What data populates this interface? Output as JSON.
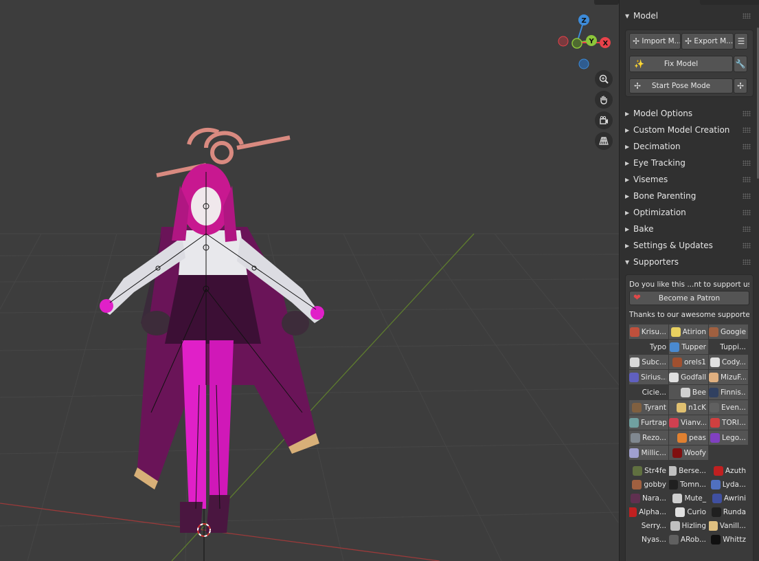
{
  "panel": {
    "model_header": "Model",
    "buttons": {
      "import": "Import M...",
      "export": "Export M...",
      "fix_model": "Fix Model",
      "start_pose_mode": "Start Pose Mode"
    },
    "sections": [
      "Model Options",
      "Custom Model Creation",
      "Decimation",
      "Eye Tracking",
      "Visemes",
      "Bone Parenting",
      "Optimization",
      "Bake",
      "Settings & Updates"
    ],
    "supporters_header": "Supporters",
    "support_question": "Do you like this ...nt to support us?",
    "become_patron": "Become a Patron",
    "thanks_text": "Thanks to our awesome supporte...",
    "supporter_buttons": [
      {
        "name": "Krisu...",
        "color": "#c0503c"
      },
      {
        "name": "Atirion",
        "color": "#e8d060"
      },
      {
        "name": "Googie",
        "color": "#a06040"
      },
      {
        "name": "Typo",
        "color": ""
      },
      {
        "name": "Tupper",
        "color": "#4a8ad0"
      },
      {
        "name": "Tuppi...",
        "color": ""
      },
      {
        "name": "Subc...",
        "color": "#d8d8d8"
      },
      {
        "name": "orels1",
        "color": "#a05030"
      },
      {
        "name": "Cody...",
        "color": "#e0e0e0"
      },
      {
        "name": "Sirius...",
        "color": "#6060c0"
      },
      {
        "name": "Godfall",
        "color": "#e0e0e0"
      },
      {
        "name": "MizuF...",
        "color": "#e0b080"
      },
      {
        "name": "Cicie...",
        "color": ""
      },
      {
        "name": "Bee",
        "color": "#d0d0d0"
      },
      {
        "name": "Finnis...",
        "color": "#304060"
      },
      {
        "name": "Tyrant",
        "color": "#806040"
      },
      {
        "name": "n1cK",
        "color": "#e0c070"
      },
      {
        "name": "Even...",
        "color": "#606060"
      },
      {
        "name": "Furtrap",
        "color": "#70a0a0"
      },
      {
        "name": "Vianv...",
        "color": "#d04050"
      },
      {
        "name": "TORI...",
        "color": "#d04040"
      },
      {
        "name": "Rezo...",
        "color": "#808890"
      },
      {
        "name": "peas",
        "color": "#e08030"
      },
      {
        "name": "Lego...",
        "color": "#8040c0"
      },
      {
        "name": "Millic...",
        "color": "#a0a0d0"
      },
      {
        "name": "Woofy",
        "color": "#801010"
      }
    ],
    "supporter_list": [
      {
        "name": "Str4fe",
        "color": "#607040"
      },
      {
        "name": "Berse...",
        "color": "#c0c0c0"
      },
      {
        "name": "Azuth",
        "color": "#c02020"
      },
      {
        "name": "gobby",
        "color": "#a06040"
      },
      {
        "name": "Tomn...",
        "color": "#202020"
      },
      {
        "name": "Lyda...",
        "color": "#5070c0"
      },
      {
        "name": "Nara...",
        "color": "#603050"
      },
      {
        "name": "Mute_",
        "color": "#d0d0d0"
      },
      {
        "name": "Awrini",
        "color": "#4050a0"
      },
      {
        "name": "Alpha...",
        "color": "#c02020"
      },
      {
        "name": "Curio",
        "color": "#e0e0e0"
      },
      {
        "name": "Runda",
        "color": "#202020"
      },
      {
        "name": "Serry...",
        "color": ""
      },
      {
        "name": "Hizling",
        "color": "#c0c0c0"
      },
      {
        "name": "Vanill...",
        "color": "#e0c080"
      },
      {
        "name": "Nyas...",
        "color": ""
      },
      {
        "name": "ARob...",
        "color": "#606060"
      },
      {
        "name": "Whittz",
        "color": "#101010"
      }
    ]
  },
  "viewport": {
    "gizmo_axes": [
      "Z",
      "Y",
      "X"
    ],
    "tool_icons": [
      "zoom-icon",
      "hand-pan-icon",
      "camera-icon",
      "grid-perspective-icon"
    ],
    "colors": {
      "x_axis": "#e8424a",
      "y_axis": "#8cc63a",
      "z_axis": "#3d8bd9",
      "background": "#3d3d3d",
      "accent_magenta": "#e020c8"
    }
  }
}
